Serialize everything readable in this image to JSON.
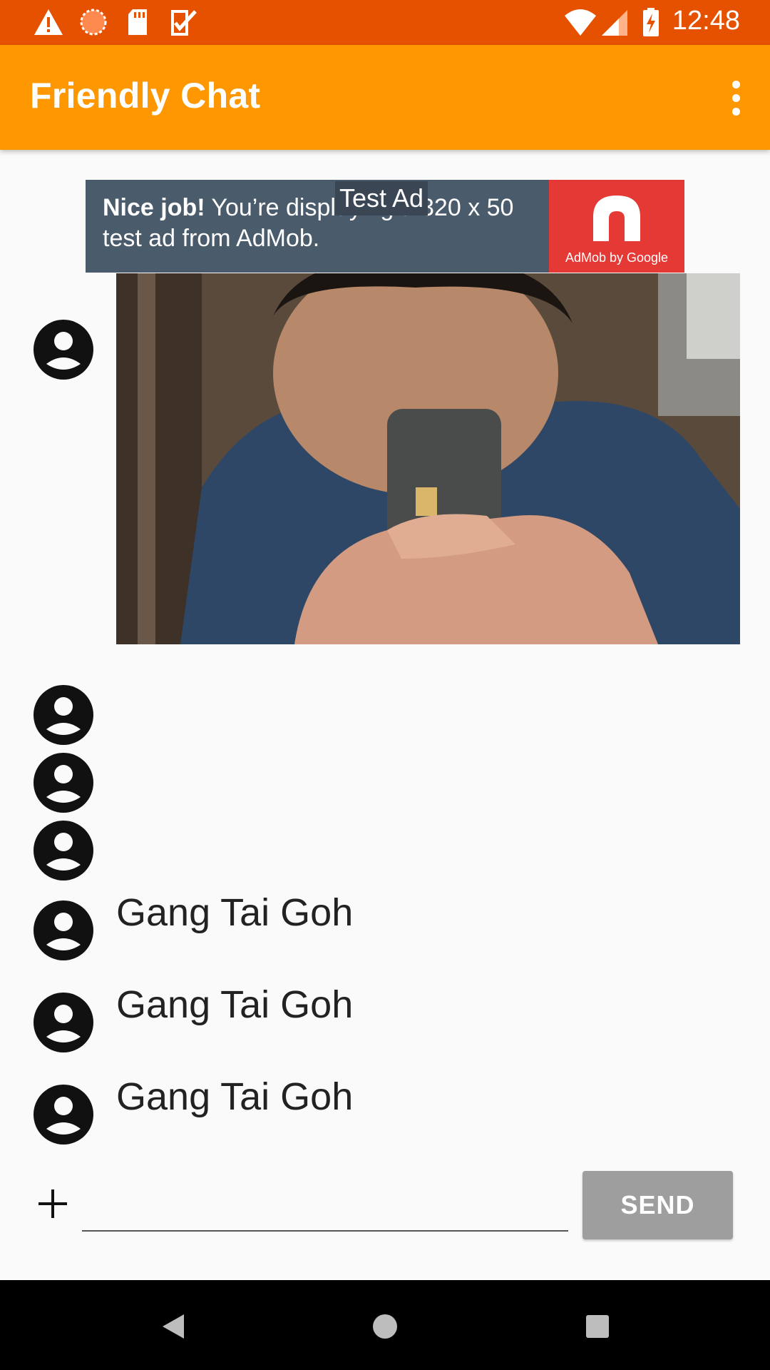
{
  "status_bar": {
    "time": "12:48",
    "icons": [
      "alert-icon",
      "sync-icon",
      "sd-card-icon",
      "clipboard-check-icon",
      "wifi-icon",
      "signal-icon",
      "battery-charging-icon"
    ]
  },
  "app_bar": {
    "title": "Friendly Chat",
    "menu_icon": "overflow-menu-icon"
  },
  "ad": {
    "label": "Test Ad",
    "headline": "Nice job!",
    "body": " You’re displaying a 320 x 50 test ad from AdMob.",
    "brand": "AdMob by Google"
  },
  "messages": [
    {
      "type": "image",
      "avatar": "account-circle-icon",
      "alt": "photo of a man taking a selfie with a phone"
    },
    {
      "type": "empty",
      "avatar": "account-circle-icon",
      "text": ""
    },
    {
      "type": "empty",
      "avatar": "account-circle-icon",
      "text": ""
    },
    {
      "type": "empty",
      "avatar": "account-circle-icon",
      "text": ""
    },
    {
      "type": "text",
      "avatar": "account-circle-icon",
      "text": "Gang Tai Goh"
    },
    {
      "type": "text",
      "avatar": "account-circle-icon",
      "text": "Gang Tai Goh"
    },
    {
      "type": "text",
      "avatar": "account-circle-icon",
      "text": "Gang Tai Goh"
    }
  ],
  "composer": {
    "add_icon": "plus-icon",
    "input_value": "",
    "input_placeholder": "",
    "send_label": "SEND"
  },
  "nav_bar": {
    "buttons": [
      "back-icon",
      "home-icon",
      "recents-icon"
    ]
  }
}
